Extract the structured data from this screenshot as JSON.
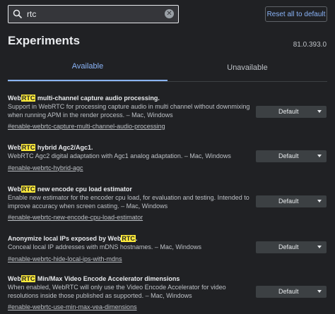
{
  "search": {
    "value": "rtc",
    "clear_icon": "clear-icon"
  },
  "toolbar": {
    "reset_label": "Reset all to default"
  },
  "header": {
    "title": "Experiments",
    "version": "81.0.393.0"
  },
  "tabs": [
    {
      "label": "Available",
      "selected": true
    },
    {
      "label": "Unavailable",
      "selected": false
    }
  ],
  "experiments": [
    {
      "title_pre": "Web",
      "title_hl": "RTC",
      "title_post": " multi-channel capture audio processing.",
      "desc": "Support in WebRTC for processing capture audio in multi channel without downmixing when running APM in the render process. – Mac, Windows",
      "link": "#enable-webrtc-capture-multi-channel-audio-processing",
      "select": "Default"
    },
    {
      "title_pre": "Web",
      "title_hl": "RTC",
      "title_post": " hybrid Agc2/Agc1.",
      "desc": "WebRTC Agc2 digital adaptation with Agc1 analog adaptation. – Mac, Windows",
      "link": "#enable-webrtc-hybrid-agc",
      "select": "Default"
    },
    {
      "title_pre": "Web",
      "title_hl": "RTC",
      "title_post": " new encode cpu load estimator",
      "desc": "Enable new estimator for the encoder cpu load, for evaluation and testing. Intended to improve accuracy when screen casting. – Mac, Windows",
      "link": "#enable-webrtc-new-encode-cpu-load-estimator",
      "select": "Default"
    },
    {
      "title_pre": "Anonymize local IPs exposed by Web",
      "title_hl": "RTC",
      "title_post": ".",
      "desc": "Conceal local IP addresses with mDNS hostnames. – Mac, Windows",
      "link": "#enable-webrtc-hide-local-ips-with-mdns",
      "select": "Default"
    },
    {
      "title_pre": "Web",
      "title_hl": "RTC",
      "title_post": " Min/Max Video Encode Accelerator dimensions",
      "desc": "When enabled, WebRTC will only use the Video Encode Accelerator for video resolutions inside those published as supported. – Mac, Windows",
      "link": "#enable-webrtc-use-min-max-vea-dimensions",
      "select": "Default"
    }
  ]
}
